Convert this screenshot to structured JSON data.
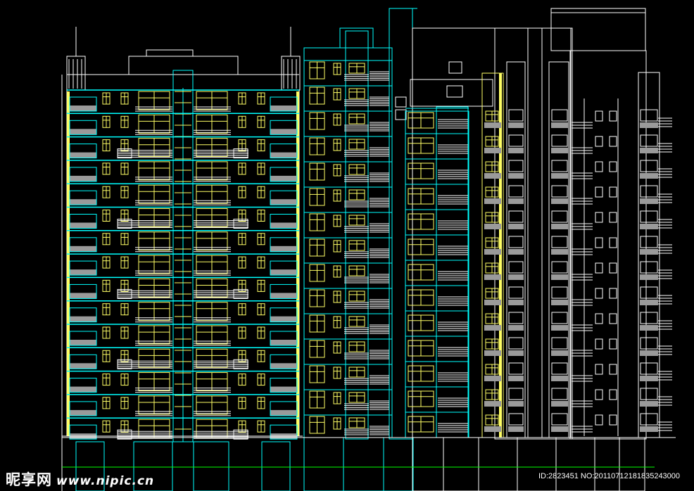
{
  "watermark": {
    "brand": "昵享网",
    "url": "www.nipic.cn",
    "id_text": "ID:2823451 NO:20110712181835243000"
  },
  "palette": {
    "background": "#000000",
    "white_line": "#ffffff",
    "cyan_line": "#00ffff",
    "yellow_line": "#ffff66",
    "grey_fill": "#9a9a9a",
    "green_ground": "#00ff00"
  }
}
